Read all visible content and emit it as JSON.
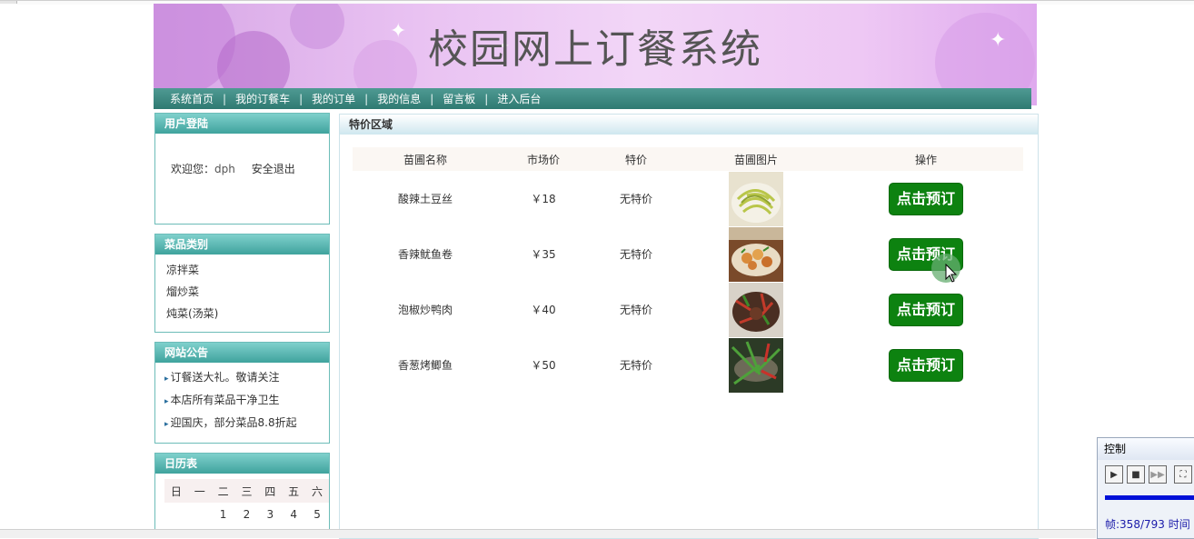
{
  "banner": {
    "title": "校园网上订餐系统"
  },
  "nav": {
    "items": [
      "系统首页",
      "我的订餐车",
      "我的订单",
      "我的信息",
      "留言板",
      "进入后台"
    ],
    "separator": "|"
  },
  "login": {
    "title": "用户登陆",
    "welcome": "欢迎您：",
    "username": "dph",
    "logout": "安全退出"
  },
  "categories": {
    "title": "菜品类别",
    "items": [
      "凉拌菜",
      "熘炒菜",
      "炖菜(汤菜)"
    ]
  },
  "notices": {
    "title": "网站公告",
    "items": [
      "订餐送大礼。敬请关注",
      "本店所有菜品干净卫生",
      "迎国庆，部分菜品8.8折起"
    ]
  },
  "calendar": {
    "title": "日历表",
    "weekdays": [
      "日",
      "一",
      "二",
      "三",
      "四",
      "五",
      "六"
    ],
    "first_row": [
      "",
      "",
      "1",
      "2",
      "3",
      "4",
      "5"
    ]
  },
  "main": {
    "title": "特价区域",
    "columns": [
      "苗圃名称",
      "市场价",
      "特价",
      "苗圃图片",
      "操作"
    ],
    "rows": [
      {
        "name": "酸辣土豆丝",
        "price": "￥18",
        "special": "无特价",
        "button": "点击预订"
      },
      {
        "name": "香辣鱿鱼卷",
        "price": "￥35",
        "special": "无特价",
        "button": "点击预订"
      },
      {
        "name": "泡椒炒鸭肉",
        "price": "￥40",
        "special": "无特价",
        "button": "点击预订"
      },
      {
        "name": "香葱烤鲫鱼",
        "price": "￥50",
        "special": "无特价",
        "button": "点击预订"
      }
    ]
  },
  "player": {
    "title": "控制",
    "frame_label": "帧:358/793 时间"
  },
  "colors": {
    "nav_bg": "#2f7a72",
    "box_header": "#3fa39d",
    "order_button": "#0d8210"
  }
}
